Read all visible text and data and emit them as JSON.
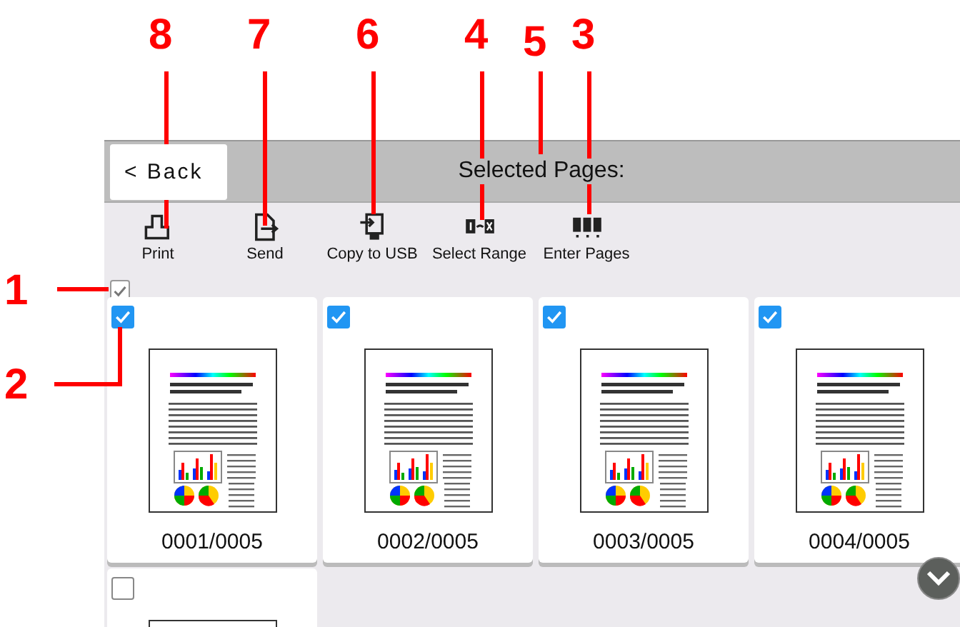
{
  "callouts": [
    {
      "label": "8"
    },
    {
      "label": "7"
    },
    {
      "label": "6"
    },
    {
      "label": "4"
    },
    {
      "label": "5"
    },
    {
      "label": "3"
    },
    {
      "label": "1"
    },
    {
      "label": "2"
    }
  ],
  "header": {
    "back_button": "< Back",
    "title": "Selected Pages:"
  },
  "toolbar": [
    {
      "label": "Print",
      "kind": "print"
    },
    {
      "label": "Send",
      "kind": "send"
    },
    {
      "label": "Copy to USB",
      "kind": "usb"
    },
    {
      "label": "Select Range",
      "kind": "range"
    },
    {
      "label": "Enter Pages",
      "kind": "pages"
    }
  ],
  "select_all": {
    "checked": true
  },
  "pages": [
    {
      "label": "0001/0005",
      "checked": true
    },
    {
      "label": "0002/0005",
      "checked": true
    },
    {
      "label": "0003/0005",
      "checked": true
    },
    {
      "label": "0004/0005",
      "checked": true
    },
    {
      "checked": false
    }
  ]
}
